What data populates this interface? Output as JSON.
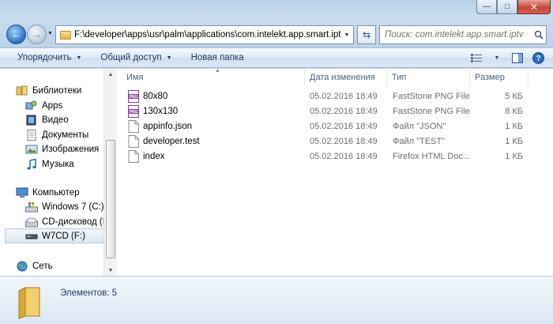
{
  "window": {
    "minimize_glyph": "—",
    "maximize_glyph": "□",
    "close_glyph": "✕"
  },
  "address_bar": {
    "path": "F:\\developer\\apps\\usr\\palm\\applications\\com.intelekt.app.smart.iptv",
    "back_glyph": "←",
    "forward_glyph": "→",
    "refresh_glyph": "⇆"
  },
  "search": {
    "placeholder": "Поиск: com.intelekt.app.smart.iptv"
  },
  "toolbar": {
    "organize_label": "Упорядочить",
    "share_label": "Общий доступ",
    "new_folder_label": "Новая папка"
  },
  "nav": {
    "items": [
      {
        "label": "Библиотеки",
        "icon": "libraries-icon"
      },
      {
        "label": "Apps",
        "icon": "apps-icon"
      },
      {
        "label": "Видео",
        "icon": "video-icon"
      },
      {
        "label": "Документы",
        "icon": "documents-icon"
      },
      {
        "label": "Изображения",
        "icon": "pictures-icon"
      },
      {
        "label": "Музыка",
        "icon": "music-icon"
      },
      {
        "label": "Компьютер",
        "icon": "computer-icon"
      },
      {
        "label": "Windows 7 (C:)",
        "icon": "windows-drive-icon"
      },
      {
        "label": "CD-дисковод (D:",
        "icon": "cd-drive-icon"
      },
      {
        "label": "W7CD (F:)",
        "icon": "usb-drive-icon"
      },
      {
        "label": "Сеть",
        "icon": "network-icon"
      }
    ]
  },
  "columns": {
    "name": "Имя",
    "date": "Дата изменения",
    "type": "Тип",
    "size": "Размер"
  },
  "files": [
    {
      "name": "80x80",
      "date": "05.02.2016 18:49",
      "type": "FastStone PNG File",
      "size": "5 КБ",
      "icon": "png-file-icon"
    },
    {
      "name": "130x130",
      "date": "05.02.2016 18:49",
      "type": "FastStone PNG File",
      "size": "8 КБ",
      "icon": "png-file-icon"
    },
    {
      "name": "appinfo.json",
      "date": "05.02.2016 18:49",
      "type": "Файл \"JSON\"",
      "size": "1 КБ",
      "icon": "blank-file-icon"
    },
    {
      "name": "developer.test",
      "date": "05.02.2016 18:49",
      "type": "Файл \"TEST\"",
      "size": "1 КБ",
      "icon": "blank-file-icon"
    },
    {
      "name": "index",
      "date": "05.02.2016 18:49",
      "type": "Firefox HTML Doc...",
      "size": "1 КБ",
      "icon": "blank-file-icon"
    }
  ],
  "status": {
    "item_count": "Элементов: 5"
  }
}
